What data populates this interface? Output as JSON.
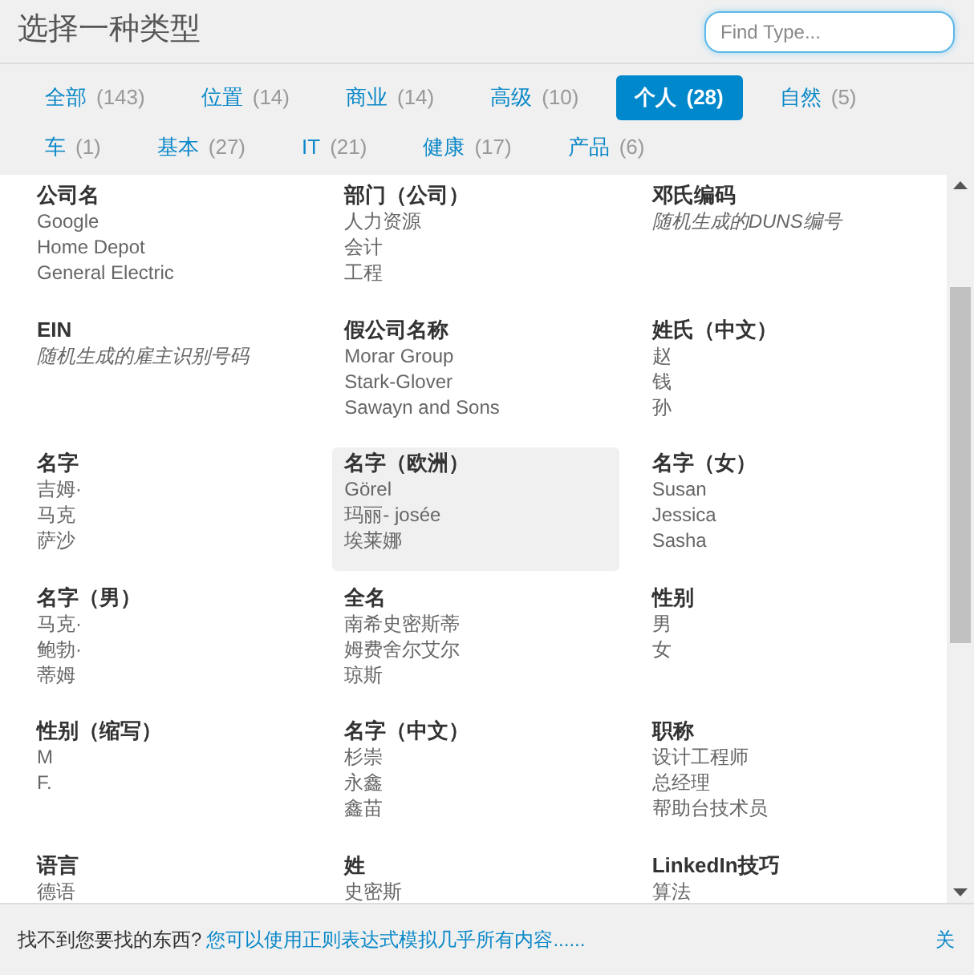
{
  "header": {
    "title": "选择一种类型",
    "search": {
      "placeholder": "Find Type..."
    }
  },
  "tabs": [
    {
      "label": "全部",
      "count": "(143)",
      "selected": false
    },
    {
      "label": "位置",
      "count": "(14)",
      "selected": false
    },
    {
      "label": "商业",
      "count": "(14)",
      "selected": false
    },
    {
      "label": "高级",
      "count": "(10)",
      "selected": false
    },
    {
      "label": "个人",
      "count": "(28)",
      "selected": true
    },
    {
      "label": "自然",
      "count": "(5)",
      "selected": false
    },
    {
      "label": "车",
      "count": "(1)",
      "selected": false
    },
    {
      "label": "基本",
      "count": "(27)",
      "selected": false
    },
    {
      "label": "IT",
      "count": "(21)",
      "selected": false
    },
    {
      "label": "健康",
      "count": "(17)",
      "selected": false
    },
    {
      "label": "产品",
      "count": "(6)",
      "selected": false
    }
  ],
  "types": [
    {
      "title": "公司名",
      "kind": "samples",
      "lines": [
        "Google",
        "Home Depot",
        "General Electric"
      ],
      "selected": false
    },
    {
      "title": "部门（公司）",
      "kind": "samples",
      "lines": [
        "人力资源",
        "会计",
        "工程"
      ],
      "selected": false
    },
    {
      "title": "邓氏编码",
      "kind": "description",
      "lines": [
        "随机生成的DUNS编号"
      ],
      "selected": false
    },
    {
      "title": "EIN",
      "kind": "description",
      "lines": [
        "随机生成的雇主识别号码"
      ],
      "selected": false
    },
    {
      "title": "假公司名称",
      "kind": "samples",
      "lines": [
        "Morar Group",
        "Stark-Glover",
        "Sawayn and Sons"
      ],
      "selected": false
    },
    {
      "title": "姓氏（中文）",
      "kind": "samples",
      "lines": [
        "赵",
        "钱",
        "孙"
      ],
      "selected": false
    },
    {
      "title": "名字",
      "kind": "samples",
      "lines": [
        "吉姆·",
        "马克",
        "萨沙"
      ],
      "selected": false
    },
    {
      "title": "名字（欧洲）",
      "kind": "samples",
      "lines": [
        "Görel",
        "玛丽- josée",
        "埃莱娜"
      ],
      "selected": true
    },
    {
      "title": "名字（女）",
      "kind": "samples",
      "lines": [
        "Susan",
        "Jessica",
        "Sasha"
      ],
      "selected": false
    },
    {
      "title": "名字（男）",
      "kind": "samples",
      "lines": [
        "马克·",
        "鲍勃·",
        "蒂姆"
      ],
      "selected": false
    },
    {
      "title": "全名",
      "kind": "samples",
      "lines": [
        "南希史密斯蒂",
        "姆费舍尔艾尔",
        "琼斯"
      ],
      "selected": false
    },
    {
      "title": "性别",
      "kind": "samples",
      "lines": [
        "男",
        "女"
      ],
      "selected": false
    },
    {
      "title": "性别（缩写）",
      "kind": "samples",
      "lines": [
        "M",
        "F."
      ],
      "selected": false
    },
    {
      "title": "名字（中文）",
      "kind": "samples",
      "lines": [
        "杉崇",
        "永鑫",
        "鑫苗"
      ],
      "selected": false
    },
    {
      "title": "职称",
      "kind": "samples",
      "lines": [
        "设计工程师",
        "总经理",
        "帮助台技术员"
      ],
      "selected": false
    },
    {
      "title": "语言",
      "kind": "samples",
      "lines": [
        "德语"
      ],
      "selected": false
    },
    {
      "title": "姓",
      "kind": "samples",
      "lines": [
        "史密斯"
      ],
      "selected": false
    },
    {
      "title": "LinkedIn技巧",
      "kind": "samples",
      "lines": [
        "算法"
      ],
      "selected": false
    }
  ],
  "footer": {
    "question": "找不到您要找的东西?",
    "link": "您可以使用正则表达式模拟几乎所有内容......",
    "close": "关"
  }
}
